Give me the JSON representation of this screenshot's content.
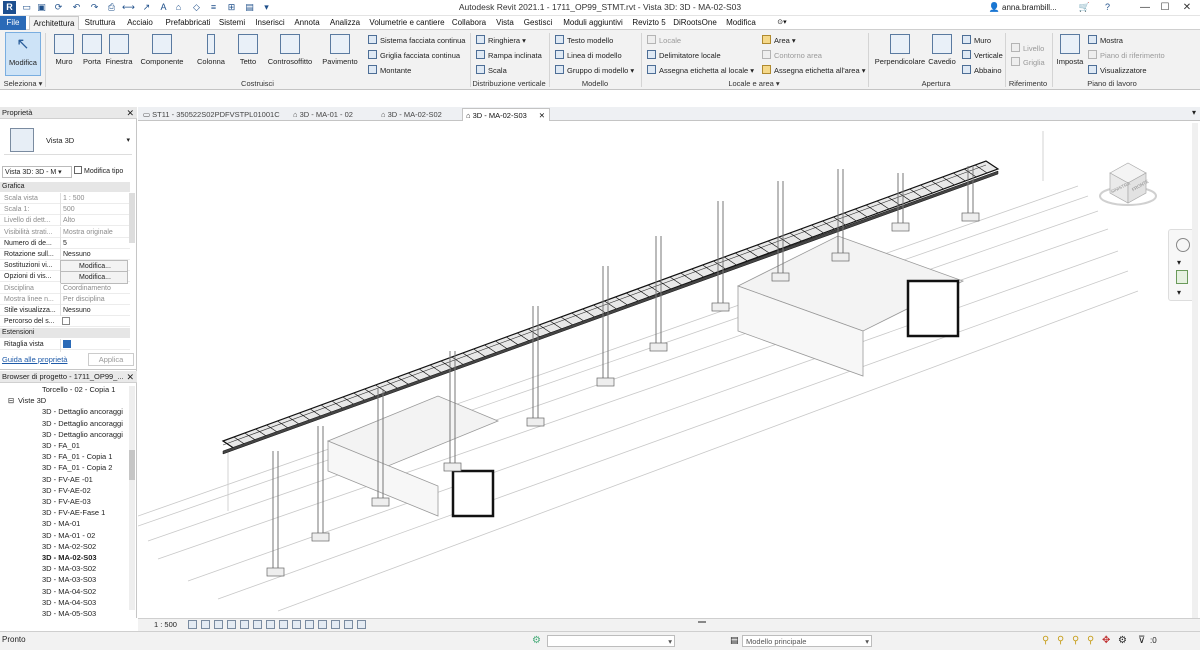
{
  "window": {
    "title": "Autodesk Revit 2021.1 - 1711_OP99_STMT.rvt - Vista 3D: 3D - MA-02-S03",
    "user": "anna.brambill...",
    "minimize": "—",
    "maximize": "☐",
    "close": "✕"
  },
  "menu": {
    "tabs": [
      "File",
      "Architettura",
      "Struttura",
      "Acciaio",
      "Prefabbricati",
      "Sistemi",
      "Inserisci",
      "Annota",
      "Analizza",
      "Volumetrie e cantiere",
      "Collabora",
      "Vista",
      "Gestisci",
      "Moduli aggiuntivi",
      "Revizto 5",
      "DiRootsOne",
      "Modifica"
    ]
  },
  "ribbon": {
    "modifica": "Modifica",
    "seleziona": "Seleziona ▾",
    "costruisci_big": [
      "Muro",
      "Porta",
      "Finestra",
      "Componente",
      "Colonna",
      "Tetto",
      "Controsoffitto",
      "Pavimento"
    ],
    "costruisci_small": [
      "Sistema facciata continua",
      "Griglia facciata continua",
      "Montante"
    ],
    "costruisci_label": "Costruisci",
    "distribuzione_small": [
      "Ringhiera ▾",
      "Rampa inclinata",
      "Scala"
    ],
    "distribuzione_label": "Distribuzione verticale",
    "modello_small": [
      "Testo modello",
      "Linea di modello",
      "Gruppo di modello ▾"
    ],
    "modello_label": "Modello",
    "locale_small": [
      "Locale",
      "Delimitatore  locale",
      "Assegna etichetta  al locale ▾"
    ],
    "area_small": [
      "Area ▾",
      "Contorno  area",
      "Assegna etichetta  all'area ▾"
    ],
    "locale_label": "Locale e area ▾",
    "apertura_big": [
      "Perpendicolare",
      "Cavedio"
    ],
    "apertura_small": [
      "Muro",
      "Verticale",
      "Abbaino"
    ],
    "apertura_label": "Apertura",
    "riferimento_small": [
      "Livello",
      "Griglia"
    ],
    "riferimento_label": "Riferimento",
    "piano_big": "Imposta",
    "piano_small": [
      "Mostra",
      "Piano di riferimento",
      "Visualizzatore"
    ],
    "piano_label": "Piano di lavoro"
  },
  "properties": {
    "header": "Proprietà",
    "type": "Vista 3D",
    "selector": "Vista 3D: 3D - M ▾",
    "edit_type": "Modifica tipo",
    "group_grafica": "Grafica",
    "rows": [
      {
        "k": "Scala vista",
        "v": "1 : 500",
        "dim": true
      },
      {
        "k": "Scala  1:",
        "v": "500",
        "dim": true
      },
      {
        "k": "Livello di dett...",
        "v": "Alto",
        "dim": true
      },
      {
        "k": "Visibilità strati...",
        "v": "Mostra originale",
        "dim": true
      },
      {
        "k": "Numero di de...",
        "v": "5",
        "dim": false
      },
      {
        "k": "Rotazione sull...",
        "v": "Nessuno",
        "dim": false
      },
      {
        "k": "Sostituzioni vi...",
        "v": "Modifica...",
        "dim": false
      },
      {
        "k": "Opzioni di vis...",
        "v": "Modifica...",
        "dim": false
      },
      {
        "k": "Disciplina",
        "v": "Coordinamento",
        "dim": true
      },
      {
        "k": "Mostra linee n...",
        "v": "Per disciplina",
        "dim": true
      },
      {
        "k": "Stile visualizza...",
        "v": "Nessuno",
        "dim": false
      },
      {
        "k": "Percorso del s...",
        "v": "",
        "dim": false
      }
    ],
    "group_estensioni": "Estensioni",
    "ritaglia": "Ritaglia vista",
    "help": "Guida alle proprietà",
    "apply": "Applica"
  },
  "browser": {
    "header": "Browser di progetto - 1711_OP99_...",
    "items": [
      "Torcello - 02 - Copia 1",
      "Viste 3D",
      "3D - Dettaglio ancoraggi",
      "3D - Dettaglio ancoraggi",
      "3D - Dettaglio ancoraggi",
      "3D - FA_01",
      "3D - FA_01 - Copia 1",
      "3D - FA_01 - Copia 2",
      "3D - FV-AE -01",
      "3D - FV-AE-02",
      "3D - FV-AE-03",
      "3D - FV-AE-Fase 1",
      "3D - MA-01",
      "3D - MA-01 - 02",
      "3D - MA-02-S02",
      "3D - MA-02-S03",
      "3D - MA-03-S02",
      "3D - MA-03-S03",
      "3D - MA-04-S02",
      "3D - MA-04-S03",
      "3D - MA-05-S03"
    ]
  },
  "viewtabs": [
    "ST11 - 350522S02PDFVSTPL01001C",
    "3D - MA-01 - 02",
    "3D - MA-02-S02",
    "3D - MA-02-S03"
  ],
  "viewcube": {
    "left": "SINISTRA",
    "front": "FRONTE"
  },
  "viewbar": {
    "scale": "1 : 500"
  },
  "status": {
    "text": "Pronto",
    "model": "Modello principale",
    "filter_count": ":0"
  }
}
